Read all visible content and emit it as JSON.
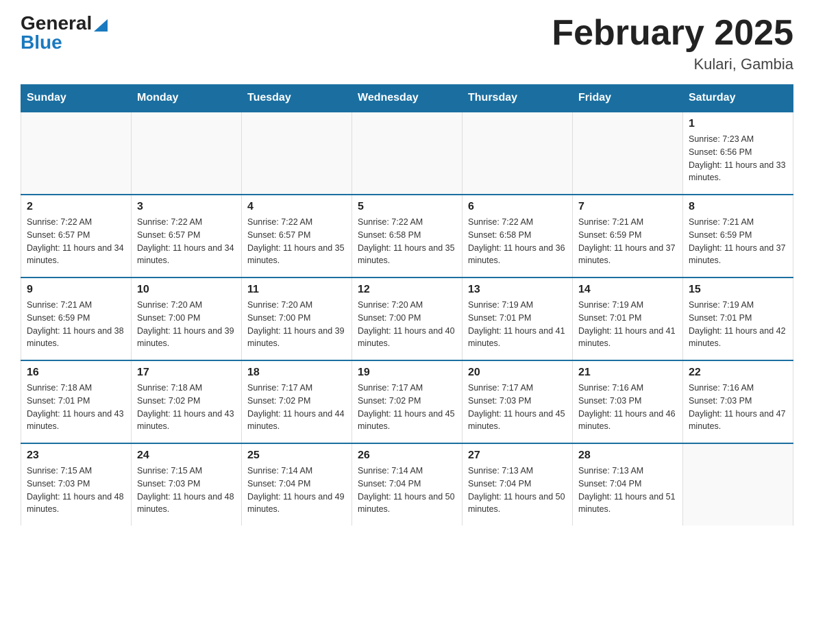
{
  "header": {
    "logo_general": "General",
    "logo_arrow": "▲",
    "logo_blue": "Blue",
    "title": "February 2025",
    "subtitle": "Kulari, Gambia"
  },
  "days_of_week": [
    "Sunday",
    "Monday",
    "Tuesday",
    "Wednesday",
    "Thursday",
    "Friday",
    "Saturday"
  ],
  "weeks": [
    [
      {
        "day": "",
        "info": ""
      },
      {
        "day": "",
        "info": ""
      },
      {
        "day": "",
        "info": ""
      },
      {
        "day": "",
        "info": ""
      },
      {
        "day": "",
        "info": ""
      },
      {
        "day": "",
        "info": ""
      },
      {
        "day": "1",
        "info": "Sunrise: 7:23 AM\nSunset: 6:56 PM\nDaylight: 11 hours and 33 minutes."
      }
    ],
    [
      {
        "day": "2",
        "info": "Sunrise: 7:22 AM\nSunset: 6:57 PM\nDaylight: 11 hours and 34 minutes."
      },
      {
        "day": "3",
        "info": "Sunrise: 7:22 AM\nSunset: 6:57 PM\nDaylight: 11 hours and 34 minutes."
      },
      {
        "day": "4",
        "info": "Sunrise: 7:22 AM\nSunset: 6:57 PM\nDaylight: 11 hours and 35 minutes."
      },
      {
        "day": "5",
        "info": "Sunrise: 7:22 AM\nSunset: 6:58 PM\nDaylight: 11 hours and 35 minutes."
      },
      {
        "day": "6",
        "info": "Sunrise: 7:22 AM\nSunset: 6:58 PM\nDaylight: 11 hours and 36 minutes."
      },
      {
        "day": "7",
        "info": "Sunrise: 7:21 AM\nSunset: 6:59 PM\nDaylight: 11 hours and 37 minutes."
      },
      {
        "day": "8",
        "info": "Sunrise: 7:21 AM\nSunset: 6:59 PM\nDaylight: 11 hours and 37 minutes."
      }
    ],
    [
      {
        "day": "9",
        "info": "Sunrise: 7:21 AM\nSunset: 6:59 PM\nDaylight: 11 hours and 38 minutes."
      },
      {
        "day": "10",
        "info": "Sunrise: 7:20 AM\nSunset: 7:00 PM\nDaylight: 11 hours and 39 minutes."
      },
      {
        "day": "11",
        "info": "Sunrise: 7:20 AM\nSunset: 7:00 PM\nDaylight: 11 hours and 39 minutes."
      },
      {
        "day": "12",
        "info": "Sunrise: 7:20 AM\nSunset: 7:00 PM\nDaylight: 11 hours and 40 minutes."
      },
      {
        "day": "13",
        "info": "Sunrise: 7:19 AM\nSunset: 7:01 PM\nDaylight: 11 hours and 41 minutes."
      },
      {
        "day": "14",
        "info": "Sunrise: 7:19 AM\nSunset: 7:01 PM\nDaylight: 11 hours and 41 minutes."
      },
      {
        "day": "15",
        "info": "Sunrise: 7:19 AM\nSunset: 7:01 PM\nDaylight: 11 hours and 42 minutes."
      }
    ],
    [
      {
        "day": "16",
        "info": "Sunrise: 7:18 AM\nSunset: 7:01 PM\nDaylight: 11 hours and 43 minutes."
      },
      {
        "day": "17",
        "info": "Sunrise: 7:18 AM\nSunset: 7:02 PM\nDaylight: 11 hours and 43 minutes."
      },
      {
        "day": "18",
        "info": "Sunrise: 7:17 AM\nSunset: 7:02 PM\nDaylight: 11 hours and 44 minutes."
      },
      {
        "day": "19",
        "info": "Sunrise: 7:17 AM\nSunset: 7:02 PM\nDaylight: 11 hours and 45 minutes."
      },
      {
        "day": "20",
        "info": "Sunrise: 7:17 AM\nSunset: 7:03 PM\nDaylight: 11 hours and 45 minutes."
      },
      {
        "day": "21",
        "info": "Sunrise: 7:16 AM\nSunset: 7:03 PM\nDaylight: 11 hours and 46 minutes."
      },
      {
        "day": "22",
        "info": "Sunrise: 7:16 AM\nSunset: 7:03 PM\nDaylight: 11 hours and 47 minutes."
      }
    ],
    [
      {
        "day": "23",
        "info": "Sunrise: 7:15 AM\nSunset: 7:03 PM\nDaylight: 11 hours and 48 minutes."
      },
      {
        "day": "24",
        "info": "Sunrise: 7:15 AM\nSunset: 7:03 PM\nDaylight: 11 hours and 48 minutes."
      },
      {
        "day": "25",
        "info": "Sunrise: 7:14 AM\nSunset: 7:04 PM\nDaylight: 11 hours and 49 minutes."
      },
      {
        "day": "26",
        "info": "Sunrise: 7:14 AM\nSunset: 7:04 PM\nDaylight: 11 hours and 50 minutes."
      },
      {
        "day": "27",
        "info": "Sunrise: 7:13 AM\nSunset: 7:04 PM\nDaylight: 11 hours and 50 minutes."
      },
      {
        "day": "28",
        "info": "Sunrise: 7:13 AM\nSunset: 7:04 PM\nDaylight: 11 hours and 51 minutes."
      },
      {
        "day": "",
        "info": ""
      }
    ]
  ]
}
